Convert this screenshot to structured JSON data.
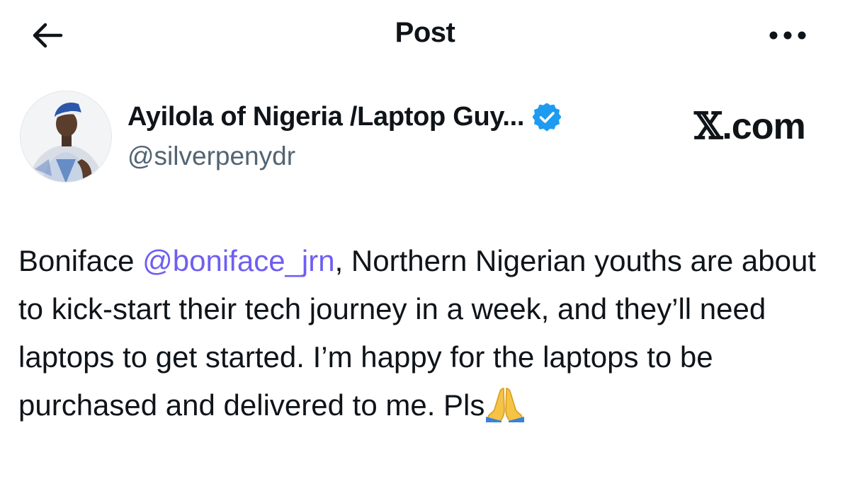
{
  "header": {
    "title": "Post"
  },
  "author": {
    "name": "Ayilola of Nigeria /Laptop Guy...",
    "handle": "@silverpenydr",
    "verified": true
  },
  "brand": {
    "mark": "𝕏",
    "text": ".com"
  },
  "tweet": {
    "lead": "Boniface ",
    "mention": "@boniface_jrn",
    "text": ", Northern Nigerian youths are about to kick-start their tech journey in a week, and they’ll need laptops to get started. I’m happy for the laptops to be purchased and delivered  to me. Pls",
    "emoji": "folded-hands"
  },
  "colors": {
    "mention": "#6e5ff2",
    "secondary_text": "#536471",
    "verified_badge": "#1d9bf0",
    "text": "#0f1419"
  },
  "icons": [
    "back-arrow-icon",
    "more-dots-icon",
    "verified-badge-icon",
    "folded-hands-emoji"
  ]
}
